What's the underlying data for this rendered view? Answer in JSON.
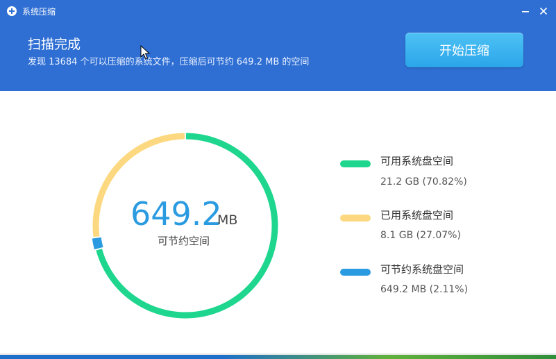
{
  "window": {
    "title": "系统压缩",
    "minimize_icon": "minimize-icon",
    "close_icon": "close-icon",
    "app_icon": "compress-app-icon"
  },
  "header": {
    "scan_title": "扫描完成",
    "summary": "发现 13684 个可以压缩的系统文件，压缩后可节约 649.2 MB 的空间",
    "start_button_label": "开始压缩",
    "background_color": "#2f6fd3"
  },
  "donut": {
    "value": "649.2",
    "unit": "MB",
    "caption": "可节约空间"
  },
  "legend": [
    {
      "label": "可用系统盘空间",
      "value": "21.2 GB  (70.82%)",
      "percent": 70.82,
      "color": "#1ed68e"
    },
    {
      "label": "已用系统盘空间",
      "value": "8.1 GB  (27.07%)",
      "percent": 27.07,
      "color": "#fcd980"
    },
    {
      "label": "可节约系统盘空间",
      "value": "649.2 MB  (2.11%)",
      "percent": 2.11,
      "color": "#2a9be0"
    }
  ]
}
